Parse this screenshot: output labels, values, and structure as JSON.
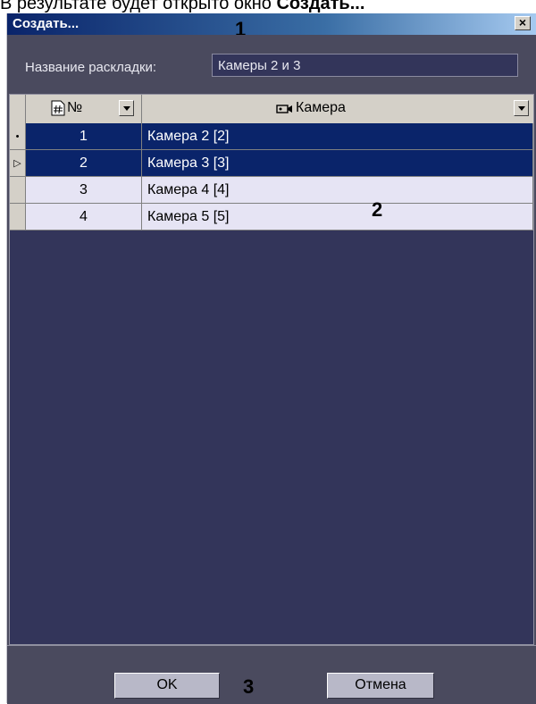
{
  "caption": {
    "text": "В результате будет открыто окно ",
    "bold": "Создать..."
  },
  "window": {
    "title": "Создать...",
    "close_label": "×",
    "markers": [
      "1",
      "2",
      "3"
    ],
    "name_label": "Название раскладки:",
    "name_value": "Камеры 2 и 3",
    "columns": {
      "num": "№",
      "camera": "Камера"
    },
    "rows": [
      {
        "indicator": "•",
        "num": "1",
        "camera": "Камера 2 [2]",
        "selected": true
      },
      {
        "indicator": "▷",
        "num": "2",
        "camera": "Камера 3 [3]",
        "selected": true
      },
      {
        "indicator": "",
        "num": "3",
        "camera": "Камера 4 [4]",
        "selected": false
      },
      {
        "indicator": "",
        "num": "4",
        "camera": "Камера 5 [5]",
        "selected": false
      }
    ],
    "ok_label": "OK",
    "cancel_label": "Отмена"
  },
  "icons": [
    "hash-icon",
    "camera-icon",
    "dropdown-arrow-icon",
    "close-icon"
  ]
}
